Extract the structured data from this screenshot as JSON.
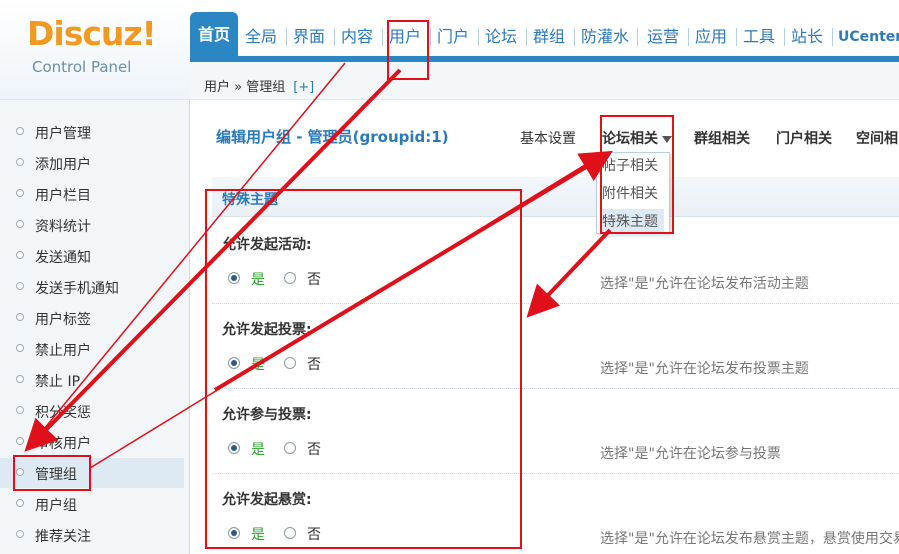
{
  "logo": {
    "word": "Discuz!",
    "sub": "Control Panel"
  },
  "topnav": [
    "首页",
    "全局",
    "界面",
    "内容",
    "用户",
    "门户",
    "论坛",
    "群组",
    "防灌水",
    "运营",
    "应用",
    "工具",
    "站长",
    "UCenter"
  ],
  "breadcrumb": {
    "path": "用户 » 管理组",
    "plus": "[+]"
  },
  "sidebar": [
    "用户管理",
    "添加用户",
    "用户栏目",
    "资料统计",
    "发送通知",
    "发送手机通知",
    "用户标签",
    "禁止用户",
    "禁止 IP",
    "积分奖惩",
    "审核用户",
    "管理组",
    "用户组",
    "推荐关注"
  ],
  "main": {
    "title": "编辑用户组 - 管理员(groupid:1)",
    "subtabs": [
      "基本设置",
      "论坛相关",
      "群组相关",
      "门户相关",
      "空间相"
    ],
    "dropdown": [
      "帖子相关",
      "附件相关",
      "特殊主题"
    ],
    "section": "特殊主题",
    "settings": [
      {
        "label": "允许发起活动:",
        "yes": "是",
        "no": "否",
        "hint": "选择\"是\"允许在论坛发布活动主题"
      },
      {
        "label": "允许发起投票:",
        "yes": "是",
        "no": "否",
        "hint": "选择\"是\"允许在论坛发布投票主题"
      },
      {
        "label": "允许参与投票:",
        "yes": "是",
        "no": "否",
        "hint": "选择\"是\"允许在论坛参与投票"
      },
      {
        "label": "允许发起悬赏:",
        "yes": "是",
        "no": "否",
        "hint": "选择\"是\"允许在论坛发布悬赏主题，悬赏使用交易"
      }
    ]
  },
  "colors": {
    "accent": "#2b86c4",
    "annotation": "#e0101a",
    "yes": "#2aa12a"
  }
}
